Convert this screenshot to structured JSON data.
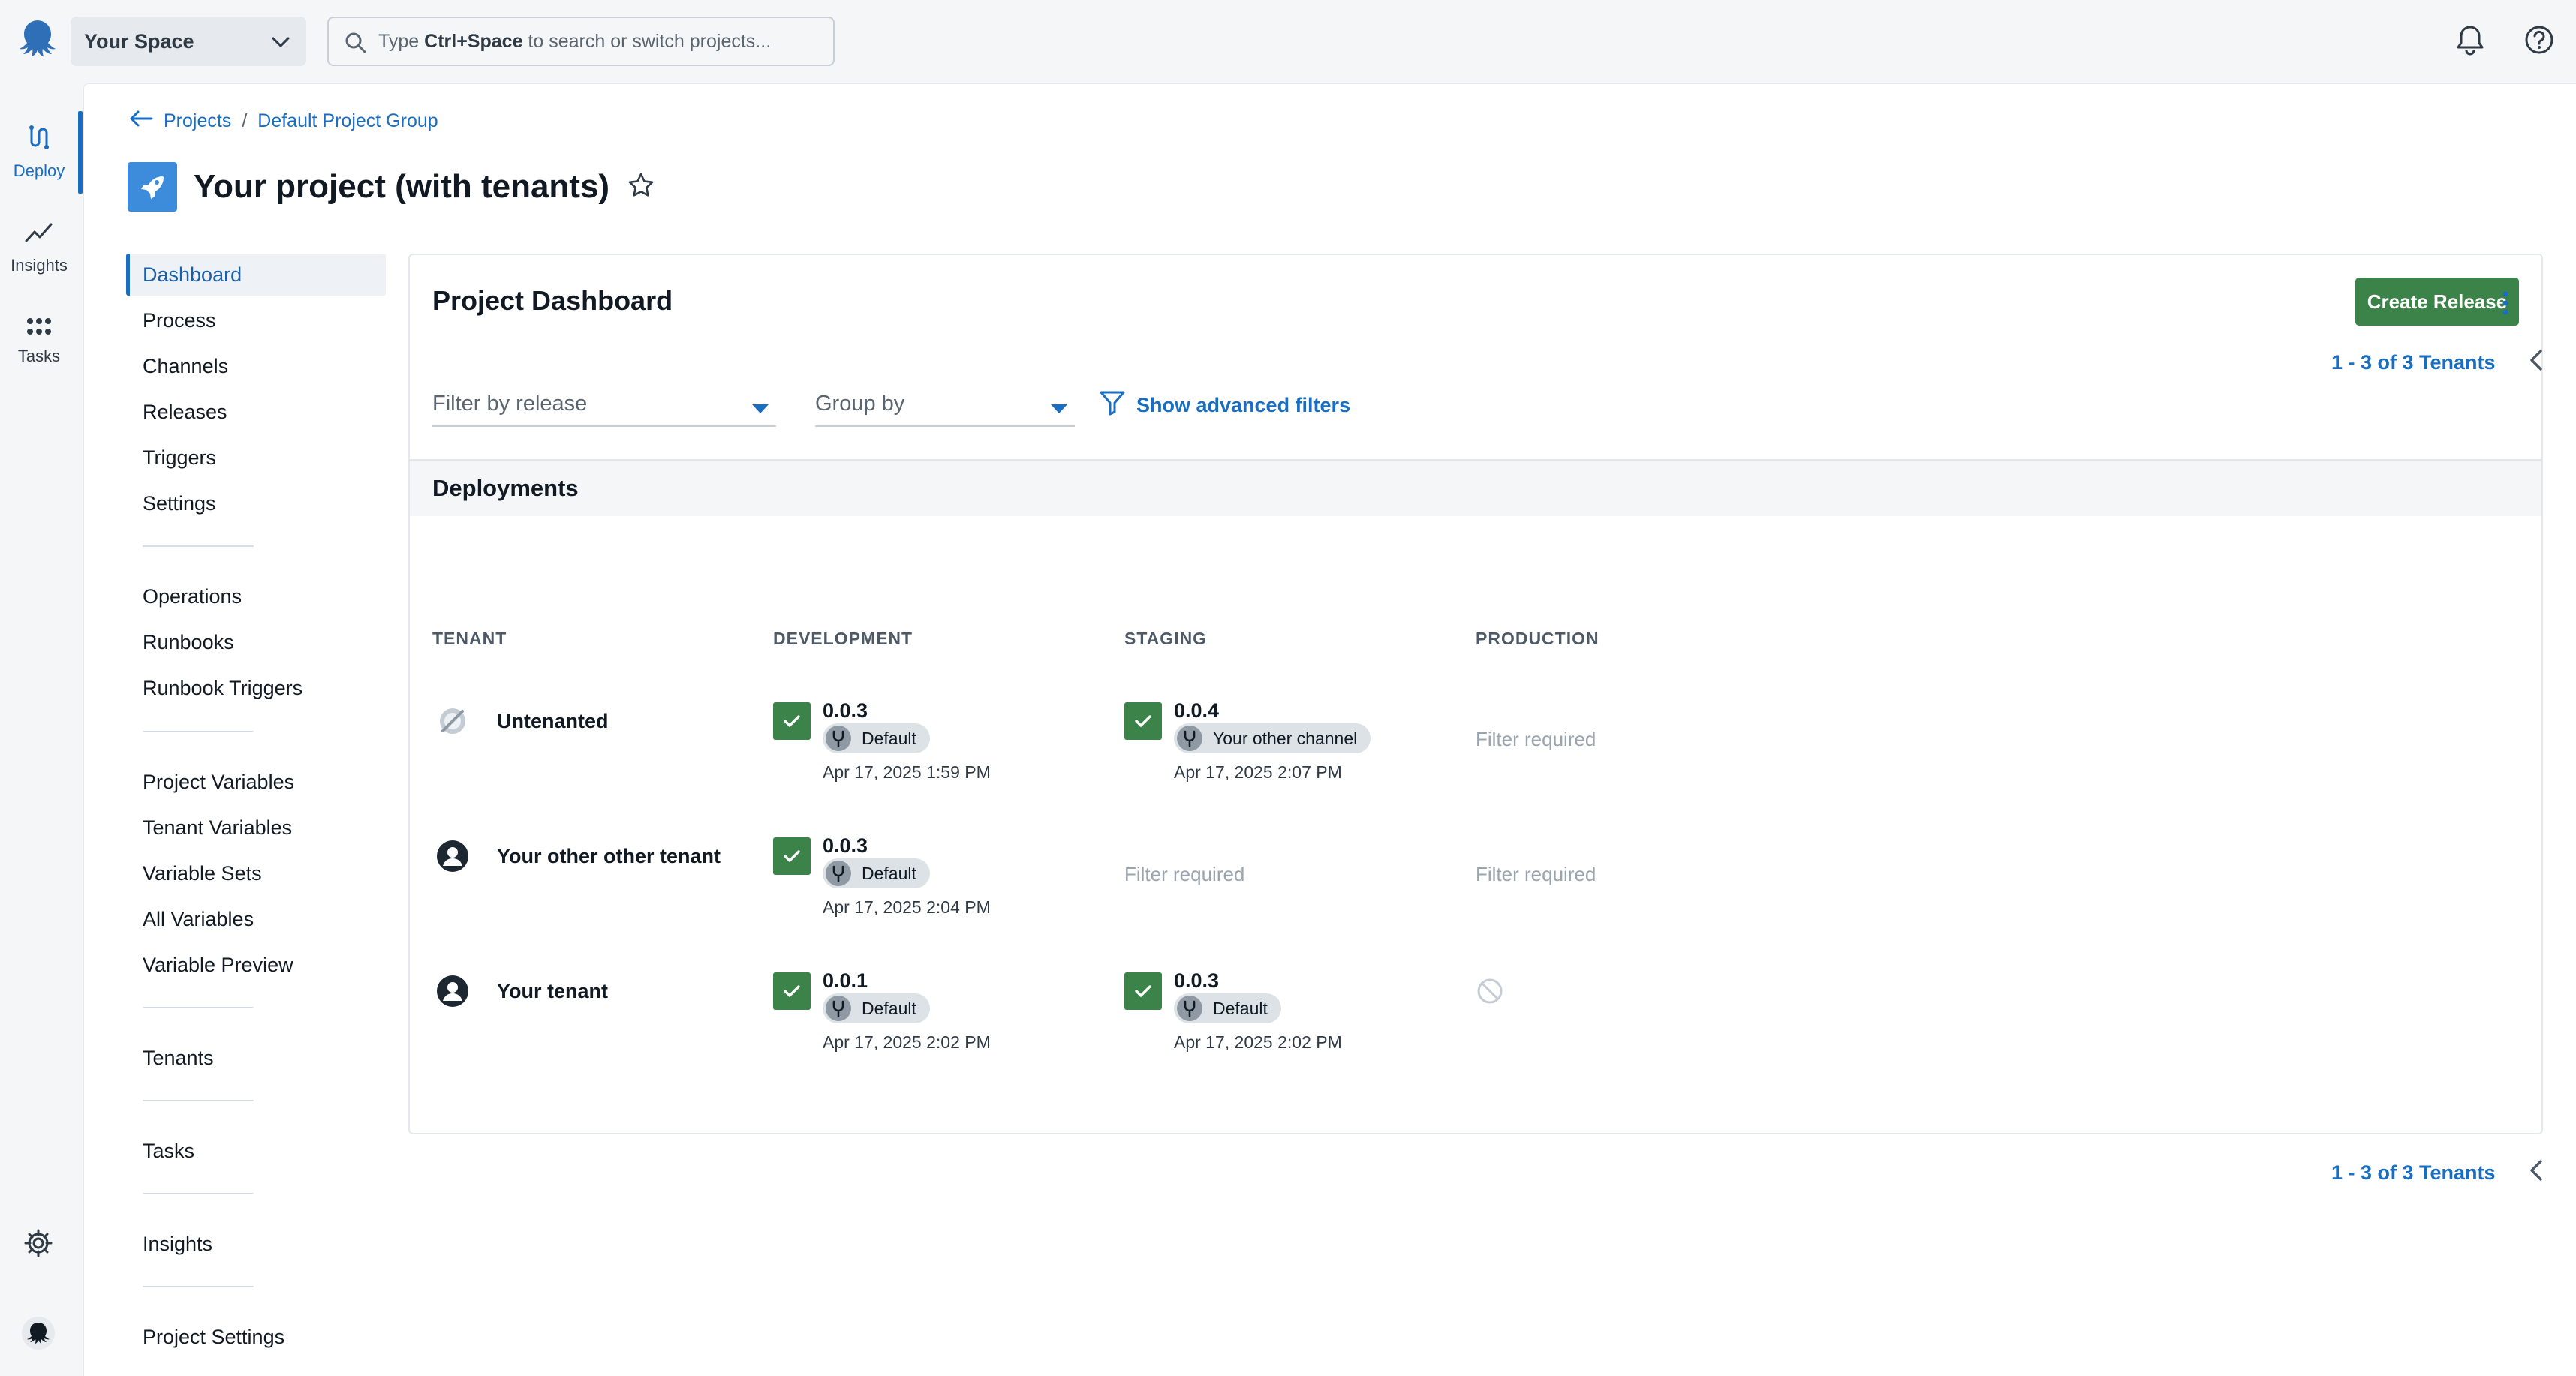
{
  "topbar": {
    "space_name": "Your Space",
    "search_prefix": "Type ",
    "search_shortcut": "Ctrl+Space",
    "search_suffix": " to search or switch projects..."
  },
  "rail": {
    "items": [
      {
        "label": "Deploy",
        "icon": "deploy-icon",
        "active": true
      },
      {
        "label": "Insights",
        "icon": "trend-icon",
        "active": false
      },
      {
        "label": "Tasks",
        "icon": "grid-icon",
        "active": false
      }
    ]
  },
  "breadcrumb": {
    "projects": "Projects",
    "separator": "/",
    "group": "Default Project Group"
  },
  "project": {
    "title": "Your project (with tenants)"
  },
  "nav": {
    "items": [
      "Dashboard",
      "Process",
      "Channels",
      "Releases",
      "Triggers",
      "Settings",
      "Operations",
      "Runbooks",
      "Runbook Triggers",
      "Project Variables",
      "Tenant Variables",
      "Variable Sets",
      "All Variables",
      "Variable Preview",
      "Tenants",
      "Tasks",
      "Insights",
      "Project Settings"
    ]
  },
  "dashboard": {
    "title": "Project Dashboard",
    "create_release": "Create Release",
    "filter_release": "Filter by release",
    "group_by": "Group by",
    "advanced_filters": "Show advanced filters",
    "pager_text": "1 - 3 of 3 Tenants",
    "section": "Deployments",
    "columns": [
      "TENANT",
      "DEVELOPMENT",
      "STAGING",
      "PRODUCTION"
    ],
    "filter_required": "Filter required",
    "rows": [
      {
        "tenant": "Untenanted",
        "development": {
          "version": "0.0.3",
          "channel": "Default",
          "date": "Apr 17, 2025 1:59 PM"
        },
        "staging": {
          "version": "0.0.4",
          "channel": "Your other channel",
          "date": "Apr 17, 2025 2:07 PM"
        }
      },
      {
        "tenant": "Your other other tenant",
        "development": {
          "version": "0.0.3",
          "channel": "Default",
          "date": "Apr 17, 2025 2:04 PM"
        }
      },
      {
        "tenant": "Your tenant",
        "development": {
          "version": "0.0.1",
          "channel": "Default",
          "date": "Apr 17, 2025 2:02 PM"
        },
        "staging": {
          "version": "0.0.3",
          "channel": "Default",
          "date": "Apr 17, 2025 2:02 PM"
        }
      }
    ]
  },
  "colors": {
    "accent": "#1a6ec2",
    "success": "#3b8348"
  }
}
